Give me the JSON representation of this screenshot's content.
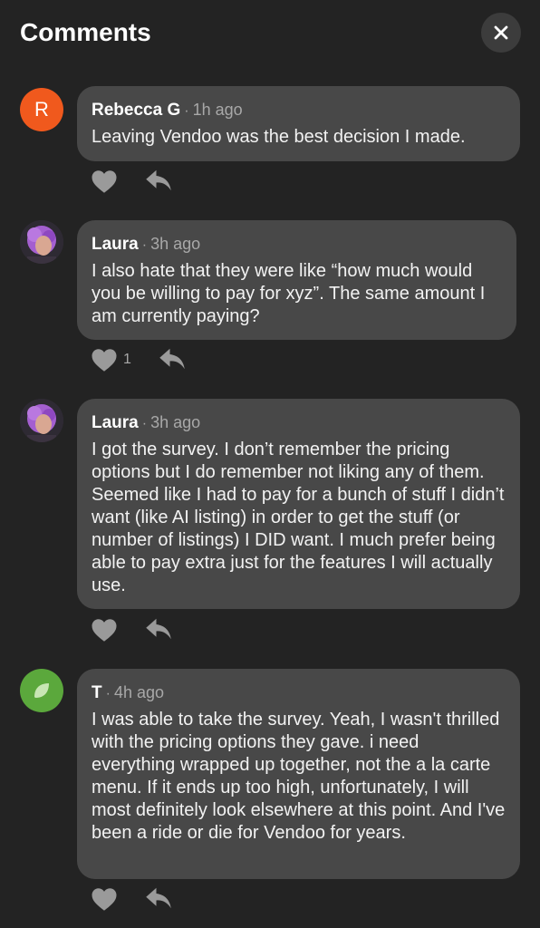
{
  "header": {
    "title": "Comments"
  },
  "comments": [
    {
      "avatar_letter": "R",
      "author": "Rebecca G",
      "time": "1h ago",
      "text": "Leaving Vendoo was the best decision I made.",
      "likes": ""
    },
    {
      "author": "Laura",
      "time": "3h ago",
      "text": "I also hate that they were like “how much would you be willing to pay for xyz”. The same amount I am currently paying?",
      "likes": "1"
    },
    {
      "author": "Laura",
      "time": "3h ago",
      "text": "I got the survey. I don’t remember the pricing options but I do remember not liking any of them. Seemed like I had to pay for a bunch of stuff I didn’t want (like AI listing) in order to get the stuff (or number of listings) I DID want. I much prefer being able to pay extra just for the features I will actually use.",
      "likes": ""
    },
    {
      "author": "T",
      "time": "4h ago",
      "text": "I was able to take the survey. Yeah, I wasn't thrilled with the pricing options they gave. i need everything wrapped up together, not the a la carte menu. If it ends up too high, unfortunately, I will most definitely look elsewhere at this point. And I've been a ride or die for Vendoo for years.",
      "likes": ""
    }
  ],
  "icons": {
    "close": "close-icon",
    "like": "heart-icon",
    "reply": "reply-arrow-icon"
  },
  "colors": {
    "background": "#232323",
    "bubble": "#484848",
    "avatar_orange": "#f0591d",
    "avatar_green": "#5ba83c",
    "muted_text": "#a8a8a8",
    "icon_gray": "#9a9a9a"
  }
}
